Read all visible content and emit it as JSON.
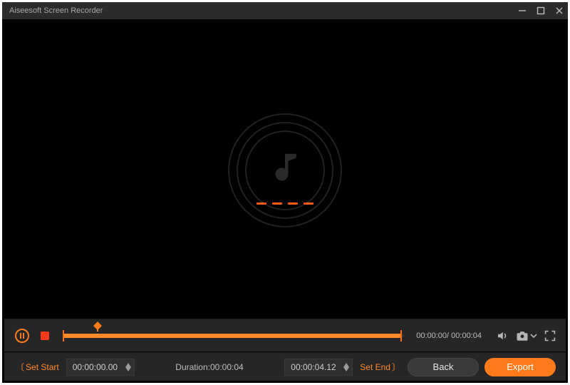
{
  "app": {
    "title": "Aiseesoft Screen Recorder"
  },
  "colors": {
    "accent": "#ff7a1a",
    "accent_light": "#ff8a2a",
    "bg_panel": "#262626",
    "text_muted": "#bdbdbd"
  },
  "transport": {
    "current_time": "00:00:00",
    "total_time": "00:00:04"
  },
  "footer": {
    "set_start_label": "Set Start",
    "set_end_label": "Set End",
    "start_time": "00:00:00.00",
    "end_time": "00:00:04.12",
    "duration_label": "Duration:",
    "duration_value": "00:00:04",
    "back_label": "Back",
    "export_label": "Export"
  }
}
